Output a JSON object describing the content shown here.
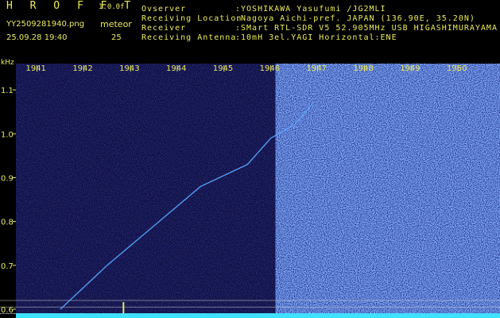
{
  "header": {
    "title": "H R O F F T",
    "version": "1.0.0f",
    "filename": "YY2509281940.png",
    "meteor_label": "meteor",
    "timestamp": "25.09.28 19:40",
    "meteor_count": "25",
    "info": [
      {
        "key": "Ovserver",
        "value": ":YOSHIKAWA Yasufumi /JG2MLI"
      },
      {
        "key": "Receiving Location",
        "value": ":Nagoya Aichi-pref. JAPAN (136.90E, 35.20N)"
      },
      {
        "key": "Receiver",
        "value": ":SMart RTL-SDR V5 52.905MHz USB HIGASHIMURAYAMA"
      },
      {
        "key": "Receiving Antenna",
        "value": ":10mH 3el.YAGI Horizontal:ENE"
      }
    ]
  },
  "colors": {
    "text": "#e8e860",
    "noise_dark": "#0a0a3a",
    "noise_bright": "#1a2a9a",
    "trail": "#5aa8ff",
    "baseline": "#40e0ff"
  },
  "chart_data": {
    "type": "heatmap",
    "y_unit": "kHz",
    "x_ticks": [
      "1941",
      "1942",
      "1943",
      "1944",
      "1945",
      "1946",
      "1947",
      "1948",
      "1949",
      "1950"
    ],
    "y_ticks": [
      "1.1",
      "1.0",
      "0.9",
      "0.8",
      "0.7",
      "0.6"
    ],
    "ylim": [
      0.58,
      1.16
    ],
    "xlim": [
      1940.55,
      1950.9
    ],
    "noise_change_x": 1946.1,
    "trail": {
      "x": [
        1941.5,
        1942.5,
        1943.5,
        1944.5,
        1945.5,
        1946.0,
        1946.5,
        1946.9
      ],
      "y": [
        0.6,
        0.7,
        0.79,
        0.88,
        0.93,
        0.99,
        1.02,
        1.07
      ]
    },
    "reference_lines_khz": [
      0.62,
      0.605,
      0.59
    ]
  }
}
